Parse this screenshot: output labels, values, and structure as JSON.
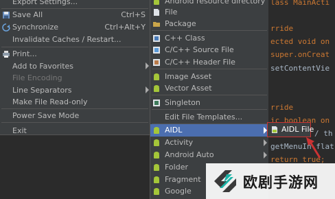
{
  "file_menu": {
    "items": [
      {
        "label": "Export Settings...",
        "shortcut": "",
        "icon": "none",
        "disabled": false
      },
      {
        "label": "Save All",
        "shortcut": "Ctrl+S",
        "icon": "save-icon",
        "disabled": false
      },
      {
        "label": "Synchronize",
        "shortcut": "Ctrl+Alt+Y",
        "icon": "sync-icon",
        "disabled": false
      },
      {
        "label": "Invalidate Caches / Restart...",
        "shortcut": "",
        "icon": "none",
        "disabled": false
      },
      {
        "label": "Print...",
        "shortcut": "",
        "icon": "print-icon",
        "disabled": false
      },
      {
        "label": "Add to Favorites",
        "shortcut": "",
        "icon": "none",
        "disabled": false
      },
      {
        "label": "File Encoding",
        "shortcut": "",
        "icon": "none",
        "disabled": true
      },
      {
        "label": "Line Separators",
        "shortcut": "",
        "icon": "none",
        "disabled": false
      },
      {
        "label": "Make File Read-only",
        "shortcut": "",
        "icon": "none",
        "disabled": false
      },
      {
        "label": "Power Save Mode",
        "shortcut": "",
        "icon": "none",
        "disabled": false
      },
      {
        "label": "Exit",
        "shortcut": "",
        "icon": "none",
        "disabled": false
      }
    ]
  },
  "new_menu": {
    "items": [
      {
        "label": "Android resource directory",
        "icon": "android-icon"
      },
      {
        "label": "File",
        "icon": "file-icon"
      },
      {
        "label": "Package",
        "icon": "package-icon"
      },
      {
        "label": "C++ Class",
        "icon": "cpp-class-icon"
      },
      {
        "label": "C/C++ Source File",
        "icon": "cpp-source-icon"
      },
      {
        "label": "C/C++ Header File",
        "icon": "cpp-header-icon"
      },
      {
        "label": "Image Asset",
        "icon": "android-icon"
      },
      {
        "label": "Vector Asset",
        "icon": "android-icon"
      },
      {
        "label": "Singleton",
        "icon": "singleton-icon"
      },
      {
        "label": "Edit File Templates...",
        "icon": "none"
      },
      {
        "label": "AIDL",
        "icon": "android-icon"
      },
      {
        "label": "Activity",
        "icon": "android-icon"
      },
      {
        "label": "Android Auto",
        "icon": "android-icon"
      },
      {
        "label": "Folder",
        "icon": "android-icon"
      },
      {
        "label": "Fragment",
        "icon": "android-icon"
      },
      {
        "label": "Google",
        "icon": "android-icon"
      }
    ],
    "selected": "AIDL"
  },
  "aidl_submenu": {
    "item": "AIDL File"
  },
  "editor": {
    "lines": [
      {
        "parts": [
          {
            "t": "lass MainActi",
            "c": "kw"
          }
        ]
      },
      {
        "parts": [
          {
            "t": "rride",
            "c": "kw"
          }
        ]
      },
      {
        "parts": [
          {
            "t": "ected void on",
            "c": "kw"
          }
        ]
      },
      {
        "parts": [
          {
            "t": "super.onCreat",
            "c": "kw"
          }
        ]
      },
      {
        "parts": [
          {
            "t": "setContentVie",
            "c": "plain"
          }
        ]
      },
      {
        "parts": [
          {
            "t": "rride",
            "c": "kw"
          }
        ]
      },
      {
        "parts": [
          {
            "t": "ic boolean on",
            "c": "kw"
          }
        ]
      },
      {
        "parts": [
          {
            "t": "/ th",
            "c": "plain"
          }
        ]
      },
      {
        "parts": [
          {
            "t": "getMenuIn flat",
            "c": "plain"
          }
        ]
      },
      {
        "parts": [
          {
            "t": "return true;",
            "c": "kw"
          }
        ]
      }
    ]
  },
  "watermark": {
    "text": "欧剧手游网"
  },
  "colors": {
    "menu_bg": "#3c3f41",
    "selected_bg": "#4b6eaf",
    "editor_bg": "#2b2b2b",
    "keyword": "#cc7832",
    "android_green": "#a4c639",
    "annotation_red": "#cc3333"
  }
}
